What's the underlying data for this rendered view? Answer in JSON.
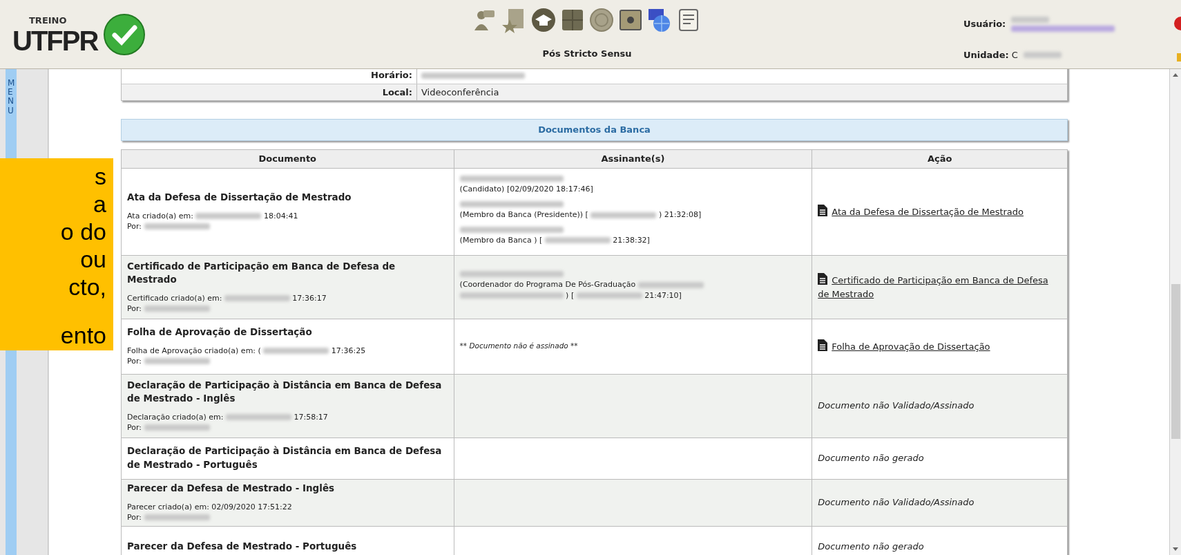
{
  "header": {
    "env_label": "TREINO",
    "logo_text": "UTFPR",
    "module_title": "Pós Stricto Sensu",
    "user_label": "Usuário:",
    "unit_label": "Unidade:",
    "unit_value": "C"
  },
  "menu_label": "MENU",
  "info_rows": [
    {
      "label": "Horário:",
      "value": [
        {
          "kind": "redacted"
        }
      ]
    },
    {
      "label": "Local:",
      "value": [
        {
          "kind": "text",
          "text": "Videoconferência"
        }
      ]
    }
  ],
  "section_title": "Documentos da Banca",
  "table": {
    "columns": [
      "Documento",
      "Assinante(s)",
      "Ação"
    ],
    "rows": [
      {
        "title": "Ata da Defesa de Dissertação de Mestrado",
        "meta": [
          [
            {
              "kind": "text",
              "text": "Ata criado(a) em:"
            },
            {
              "kind": "redacted"
            },
            {
              "kind": "text",
              "text": "18:04:41"
            }
          ],
          [
            {
              "kind": "text",
              "text": "Por:"
            },
            {
              "kind": "redacted"
            }
          ]
        ],
        "signers": [
          [
            [
              {
                "kind": "redacted"
              }
            ],
            [
              {
                "kind": "text",
                "text": "(Candidato) [02/09/2020 18:17:46]"
              }
            ]
          ],
          [
            [
              {
                "kind": "redacted"
              }
            ],
            [
              {
                "kind": "text",
                "text": "(Membro da Banca (Presidente)) ["
              },
              {
                "kind": "redacted"
              },
              {
                "kind": "text",
                "text": ") 21:32:08]"
              }
            ]
          ],
          [
            [
              {
                "kind": "redacted"
              }
            ],
            [
              {
                "kind": "text",
                "text": "(Membro da Banca ) ["
              },
              {
                "kind": "redacted"
              },
              {
                "kind": "text",
                "text": "21:38:32]"
              }
            ]
          ]
        ],
        "action": {
          "kind": "link",
          "text": "Ata da Defesa de Dissertação de Mestrado"
        }
      },
      {
        "title": "Certificado de Participação em Banca de Defesa de Mestrado",
        "meta": [
          [
            {
              "kind": "text",
              "text": "Certificado criado(a) em:"
            },
            {
              "kind": "redacted"
            },
            {
              "kind": "text",
              "text": "17:36:17"
            }
          ],
          [
            {
              "kind": "text",
              "text": "Por:"
            },
            {
              "kind": "redacted"
            }
          ]
        ],
        "signers": [
          [
            [
              {
                "kind": "redacted"
              }
            ],
            [
              {
                "kind": "text",
                "text": "(Coordenador do Programa De Pós-Graduação"
              },
              {
                "kind": "redacted"
              }
            ],
            [
              {
                "kind": "redacted"
              },
              {
                "kind": "text",
                "text": ") ["
              },
              {
                "kind": "redacted"
              },
              {
                "kind": "text",
                "text": "21:47:10]"
              }
            ]
          ]
        ],
        "action": {
          "kind": "link",
          "text": "Certificado de Participação em Banca de Defesa de Mestrado"
        }
      },
      {
        "title": "Folha de Aprovação de Dissertação",
        "meta": [
          [
            {
              "kind": "text",
              "text": "Folha de Aprovação criado(a) em: ("
            },
            {
              "kind": "redacted"
            },
            {
              "kind": "text",
              "text": "17:36:25"
            }
          ],
          [
            {
              "kind": "text",
              "text": "Por:"
            },
            {
              "kind": "redacted"
            }
          ]
        ],
        "signer_note": "** Documento não é assinado **",
        "action": {
          "kind": "link",
          "text": "Folha de Aprovação de Dissertação"
        }
      },
      {
        "title": "Declaração de Participação à Distância em Banca de Defesa de Mestrado - Inglês",
        "meta": [
          [
            {
              "kind": "text",
              "text": "Declaração criado(a) em:"
            },
            {
              "kind": "redacted"
            },
            {
              "kind": "text",
              "text": "17:58:17"
            }
          ],
          [
            {
              "kind": "text",
              "text": "Por:"
            },
            {
              "kind": "redacted"
            }
          ]
        ],
        "action": {
          "kind": "status",
          "text": "Documento não Validado/Assinado"
        }
      },
      {
        "title": "Declaração de Participação à Distância em Banca de Defesa de Mestrado - Português",
        "action": {
          "kind": "status",
          "text": "Documento não gerado"
        }
      },
      {
        "title": "Parecer da Defesa de Mestrado - Inglês",
        "meta": [
          [
            {
              "kind": "text",
              "text": "Parecer criado(a) em: 02/09/2020 17:51:22"
            }
          ],
          [
            {
              "kind": "text",
              "text": "Por:"
            },
            {
              "kind": "redacted"
            }
          ]
        ],
        "action": {
          "kind": "status",
          "text": "Documento não Validado/Assinado"
        }
      },
      {
        "title": "Parecer da Defesa de Mestrado - Português",
        "action": {
          "kind": "status",
          "text": "Documento não gerado"
        }
      }
    ]
  },
  "callout": {
    "paragraphs": [
      [
        "s",
        "a",
        "o do",
        "ou",
        "cto,"
      ],
      [
        "ento"
      ]
    ]
  }
}
